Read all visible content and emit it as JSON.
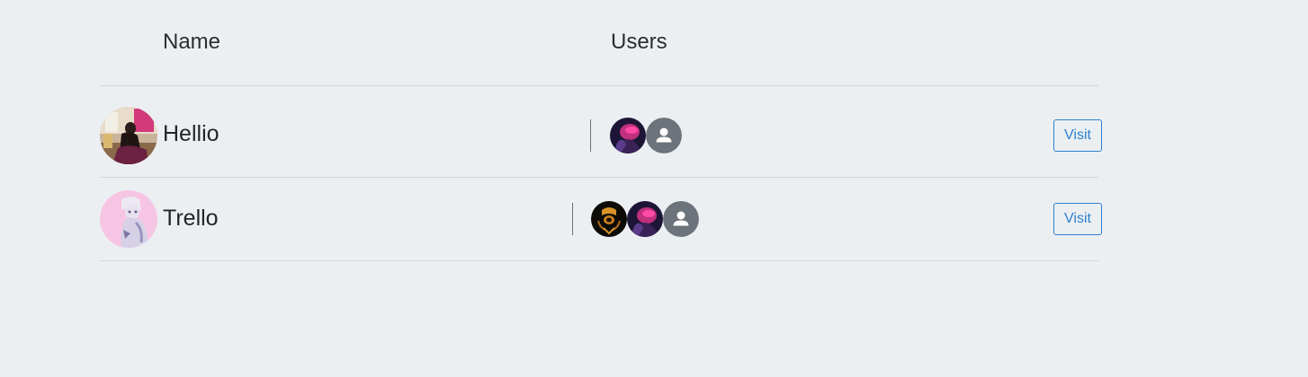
{
  "table": {
    "columns": {
      "name": "Name",
      "users": "Users"
    },
    "rows": [
      {
        "name": "Hellio",
        "avatar_icon": "org-avatar-photo-hellio",
        "users": [
          {
            "avatar_icon": "user-avatar-photo-neon"
          },
          {
            "avatar_icon": "default-user-icon"
          }
        ],
        "action_label": "Visit"
      },
      {
        "name": "Trello",
        "avatar_icon": "org-avatar-photo-trello",
        "users": [
          {
            "avatar_icon": "user-avatar-photo-emblem"
          },
          {
            "avatar_icon": "user-avatar-photo-neon"
          },
          {
            "avatar_icon": "default-user-icon"
          }
        ],
        "action_label": "Visit"
      }
    ]
  },
  "colors": {
    "background": "#eceff2",
    "accent": "#2b80d0",
    "divider": "#d4d7db",
    "default_avatar": "#6c737a"
  }
}
